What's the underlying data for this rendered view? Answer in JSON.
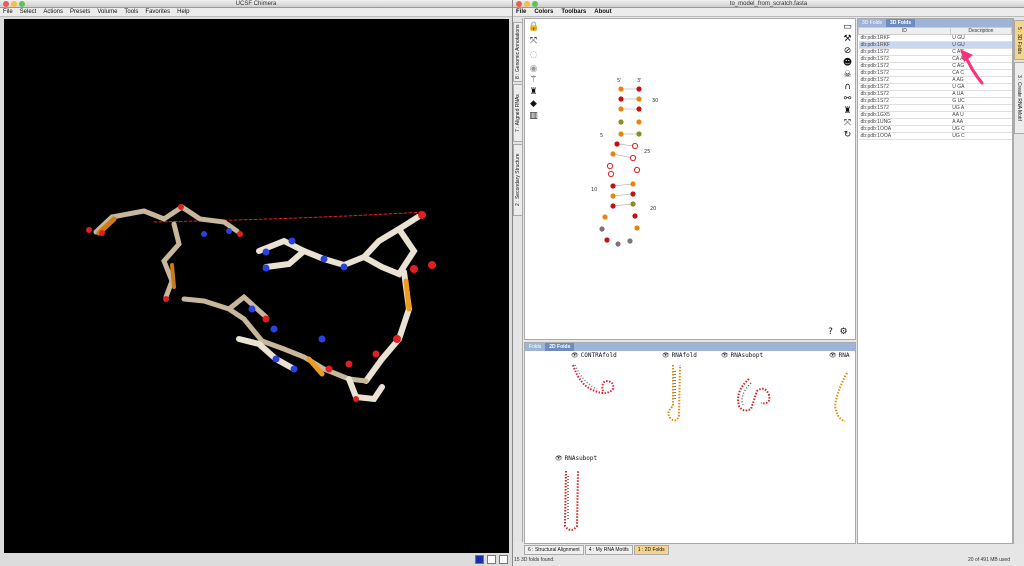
{
  "chimera": {
    "title": "UCSF Chimera",
    "menu": [
      "File",
      "Select",
      "Actions",
      "Presets",
      "Volume",
      "Tools",
      "Favorites",
      "Help"
    ]
  },
  "app": {
    "title": "to_model_from_scratch.fasta",
    "menu": [
      "File",
      "Colors",
      "Toolbars",
      "About"
    ],
    "left_tabs": [
      "8 : Genomic Annotations",
      "7 : Aligned RNAs",
      "2 : Secondary Structure"
    ],
    "right_tabs": [
      "5 : 3D Folds",
      "3 : Create RNA Motif"
    ],
    "structure_labels": {
      "five_prime": "5'",
      "three_prime": "3'",
      "n30": "30",
      "n5": "5",
      "n25": "25",
      "n10": "10",
      "n20": "20"
    },
    "folds_panel": {
      "tabs": [
        "Folds",
        "2D Folds"
      ],
      "algorithms": [
        "CONTRAfold",
        "RNAfold",
        "RNAsubopt",
        "RNA",
        "RNAsubopt"
      ]
    },
    "bottom_tabs": [
      "6 : Structural Alignment",
      "4 : My RNA Motifs",
      "1 : 2D Folds"
    ],
    "status": "15 3D folds found.",
    "panel3d": {
      "tabs": [
        "3D Folds",
        "3D Folds"
      ],
      "headers": [
        "ID",
        "Description"
      ],
      "rows": [
        {
          "id": "db:pdb:1RKF",
          "desc": "U GU"
        },
        {
          "id": "db:pdb:1RKF",
          "desc": "U GU"
        },
        {
          "id": "db:pdb:1S72",
          "desc": "C AG"
        },
        {
          "id": "db:pdb:1S72",
          "desc": "CA A"
        },
        {
          "id": "db:pdb:1S72",
          "desc": "C AG"
        },
        {
          "id": "db:pdb:1S72",
          "desc": "CA C"
        },
        {
          "id": "db:pdb:1S72",
          "desc": "A AG"
        },
        {
          "id": "db:pdb:1S72",
          "desc": "U GA"
        },
        {
          "id": "db:pdb:1S72",
          "desc": "A UA"
        },
        {
          "id": "db:pdb:1S72",
          "desc": "G UC"
        },
        {
          "id": "db:pdb:1S72",
          "desc": "UG A"
        },
        {
          "id": "db:pdb:1GX5",
          "desc": "AA U"
        },
        {
          "id": "db:pdb:1UNG",
          "desc": "A AA"
        },
        {
          "id": "db:pdb:1OOA",
          "desc": "UG C"
        },
        {
          "id": "db:pdb:1OOA",
          "desc": "UG C"
        }
      ],
      "selected_row": 1,
      "memory": "20 of 491 MB used"
    },
    "colors": {
      "accent": "#f3d58c",
      "selection": "#c8d8f0",
      "arrow": "#ff2e7a"
    }
  }
}
